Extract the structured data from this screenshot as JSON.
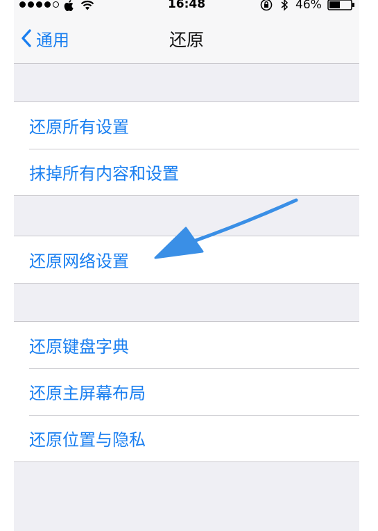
{
  "status_bar": {
    "time": "16:48",
    "battery": "46%"
  },
  "nav": {
    "back_label": "通用",
    "title": "还原"
  },
  "groups": [
    {
      "items": [
        "还原所有设置",
        "抹掉所有内容和设置"
      ]
    },
    {
      "items": [
        "还原网络设置"
      ]
    },
    {
      "items": [
        "还原键盘字典",
        "还原主屏幕布局",
        "还原位置与隐私"
      ]
    }
  ],
  "colors": {
    "accent": "#1a7ff0",
    "annotation_arrow": "#3a8fe6",
    "background": "#efeff4"
  }
}
